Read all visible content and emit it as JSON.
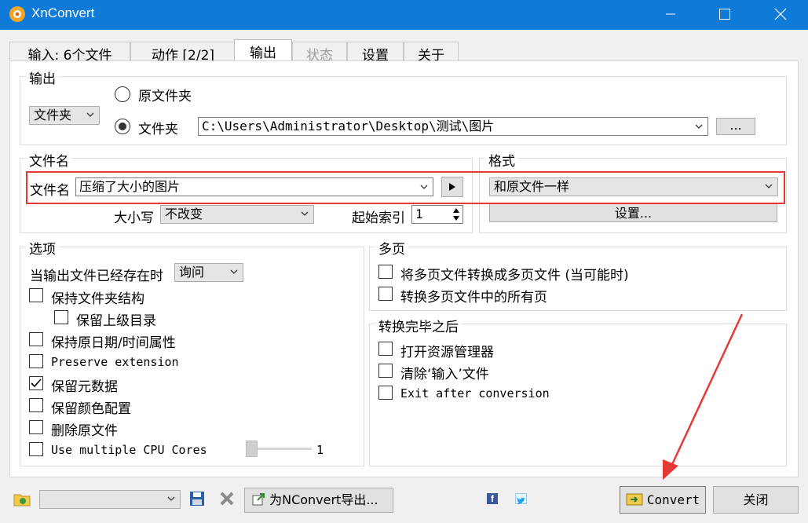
{
  "window": {
    "title": "XnConvert"
  },
  "tabs": [
    {
      "label": "输入:  6个文件"
    },
    {
      "label": "动作 [2/2]"
    },
    {
      "label": "输出"
    },
    {
      "label": "状态"
    },
    {
      "label": "设置"
    },
    {
      "label": "关于"
    }
  ],
  "output": {
    "group_label": "输出",
    "dest_type": "文件夹",
    "radio_original": "原文件夹",
    "radio_folder": "文件夹",
    "folder_path": "C:\\Users\\Administrator\\Desktop\\测试\\图片",
    "browse_label": "..."
  },
  "filename": {
    "group_label": "文件名",
    "label": "文件名",
    "value": "压缩了大小的图片",
    "case_label": "大小写",
    "case_value": "不改变",
    "start_index_label": "起始索引",
    "start_index_value": "1"
  },
  "format": {
    "group_label": "格式",
    "value": "和原文件一样",
    "settings_label": "设置..."
  },
  "options": {
    "group_label": "选项",
    "exists_label": "当输出文件已经存在时",
    "exists_value": "询问",
    "items": [
      {
        "label": "保持文件夹结构",
        "checked": false
      },
      {
        "label": "保留上级目录",
        "checked": false
      },
      {
        "label": "保持原日期/时间属性",
        "checked": false
      },
      {
        "label": "Preserve extension",
        "checked": false
      },
      {
        "label": "保留元数据",
        "checked": true
      },
      {
        "label": "保留颜色配置",
        "checked": false
      },
      {
        "label": "删除原文件",
        "checked": false
      },
      {
        "label": "Use multiple CPU Cores",
        "checked": false
      }
    ],
    "cpu_cores_value": "1"
  },
  "multipage": {
    "group_label": "多页",
    "items": [
      {
        "label": "将多页文件转换成多页文件 (当可能时)",
        "checked": false
      },
      {
        "label": "转换多页文件中的所有页",
        "checked": false
      }
    ]
  },
  "after": {
    "group_label": "转换完毕之后",
    "items": [
      {
        "label": "打开资源管理器",
        "checked": false
      },
      {
        "label": "清除‘输入’文件",
        "checked": false
      },
      {
        "label": "Exit after conversion",
        "checked": false
      }
    ]
  },
  "bottom": {
    "export_label": "为NConvert导出...",
    "convert_label": "Convert",
    "close_label": "关闭"
  },
  "colors": {
    "titlebar": "#0f7ad8",
    "highlight": "#e53935"
  },
  "icons": [
    "xnconvert-icon",
    "minimize-icon",
    "maximize-icon",
    "close-icon",
    "folder-open-icon",
    "save-icon",
    "delete-icon",
    "export-icon",
    "facebook-icon",
    "twitter-icon",
    "convert-icon",
    "play-icon"
  ]
}
